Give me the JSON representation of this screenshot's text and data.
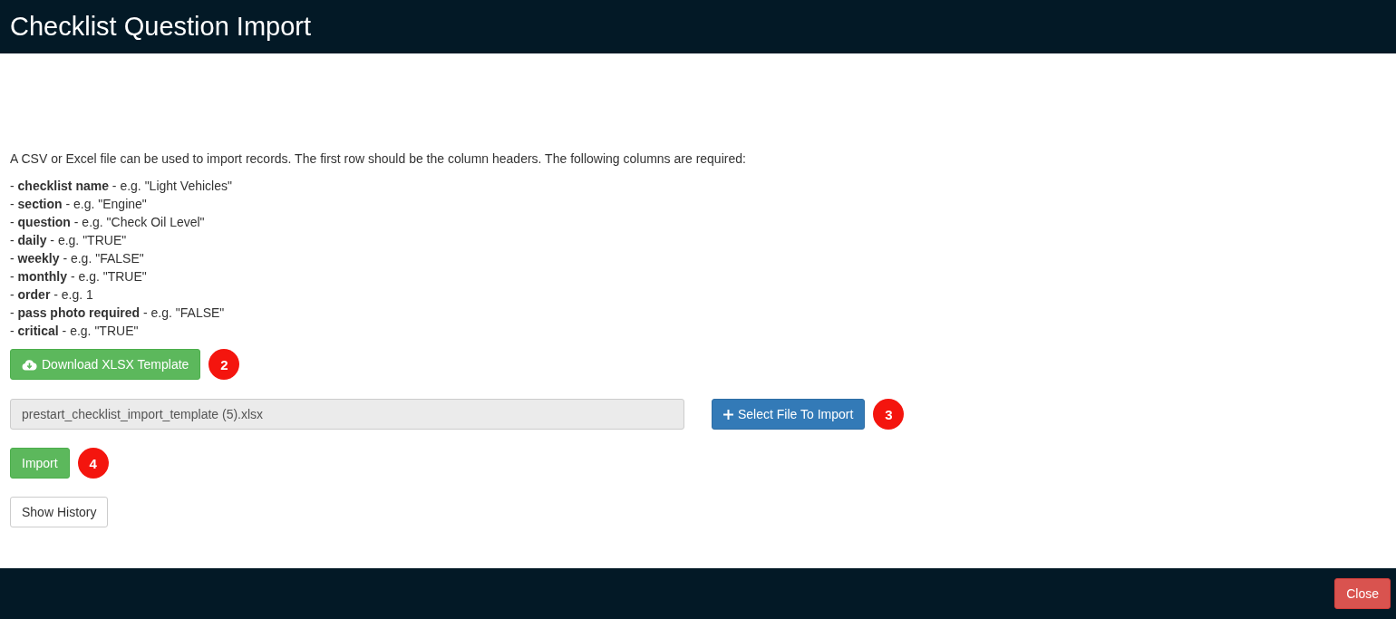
{
  "header": {
    "title": "Checklist Question Import"
  },
  "intro": "A CSV or Excel file can be used to import records. The first row should be the column headers. The following columns are required:",
  "columns": [
    "- **checklist name** - e.g. \"Light Vehicles\"",
    "- **section** - e.g. \"Engine\"",
    "- **question** - e.g. \"Check Oil Level\"",
    "- **daily** - e.g. \"TRUE\"",
    "- **weekly** - e.g. \"FALSE\"",
    "- **monthly** - e.g. \"TRUE\"",
    "- **order** - e.g. 1",
    "- **pass photo required** - e.g. \"FALSE\"",
    "- **critical** - e.g. \"TRUE\""
  ],
  "download_button": {
    "label": "Download XLSX Template",
    "badge": "2"
  },
  "file_field": {
    "value": "prestart_checklist_import_template (5).xlsx"
  },
  "select_button": {
    "label": "Select File To Import",
    "badge": "3"
  },
  "import_button": {
    "label": "Import",
    "badge": "4"
  },
  "history_button": {
    "label": "Show History"
  },
  "footer": {
    "close_button": "Close"
  }
}
